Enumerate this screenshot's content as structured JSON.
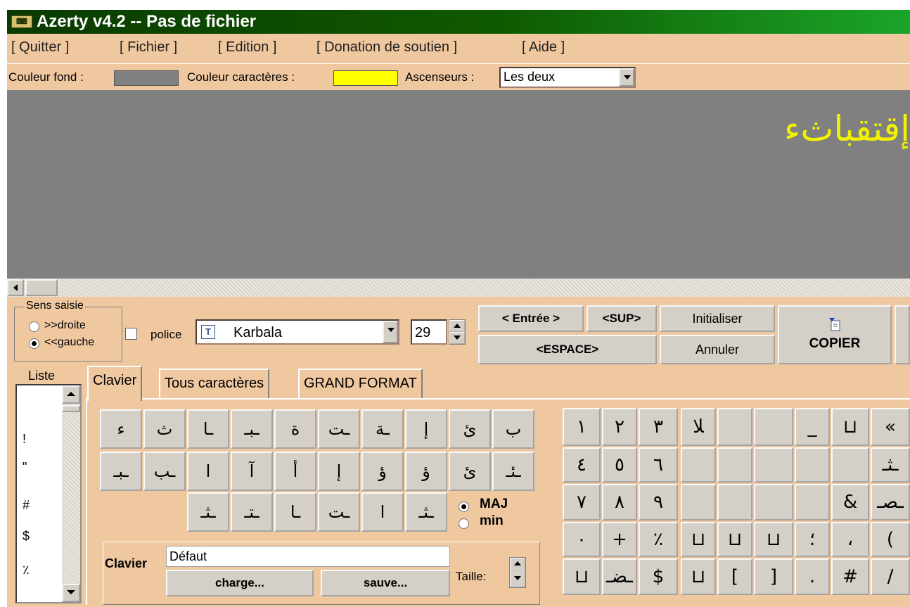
{
  "title": "Azerty v4.2 -- Pas de fichier",
  "app_icon": "keyboard-icon",
  "menu": [
    {
      "label": "[ Quitter ]"
    },
    {
      "label": "[ Fichier ]"
    },
    {
      "label": "[ Edition ]"
    },
    {
      "label": "[ Donation de soutien ]"
    },
    {
      "label": "[ Aide ]"
    }
  ],
  "toolbar": {
    "bg_label": "Couleur fond :",
    "bg_color": "#808080",
    "fg_label": "Couleur caractères :",
    "fg_color": "#ffff00",
    "scroll_label": "Ascenseurs :",
    "scroll_value": "Les deux"
  },
  "editor": {
    "text": "إقتقباثء",
    "bg_color": "#808080",
    "text_color": "#f2f200"
  },
  "direction": {
    "legend": "Sens saisie",
    "option_right": ">>droite",
    "option_left": "<<gauche",
    "selected": "<<gauche"
  },
  "font": {
    "checkbox_label": "police",
    "name": "Karbala",
    "size": "29"
  },
  "buttons": {
    "enter": "< Entrée >",
    "sup": "<SUP>",
    "space": "<ESPACE>",
    "init": "Initialiser",
    "cancel": "Annuler",
    "copy": "COPIER"
  },
  "list": {
    "label": "Liste",
    "items": [
      "!",
      "\"",
      "#",
      "$",
      "٪"
    ]
  },
  "tabs": [
    "Clavier",
    "Tous caractères",
    "GRAND FORMAT"
  ],
  "active_tab": "Clavier",
  "keyboard_rows": [
    [
      "ء",
      "ث",
      "ـا",
      "ـبـ",
      "ة",
      "ـت",
      "ـة",
      "إ",
      "ىٔ",
      "ب"
    ],
    [
      "ـبـ",
      "ـب",
      "ا",
      "آ",
      "أ",
      "إ",
      "ؤ",
      "ؤ",
      "ئ",
      "ـئـ"
    ],
    [
      "ـثـ",
      "ـتـ",
      "ـا",
      "ـت",
      "ا",
      "ـثـ"
    ]
  ],
  "case": {
    "maj": "MAJ",
    "min": "min",
    "selected": "MAJ"
  },
  "clavier": {
    "label": "Clavier",
    "value": "Défaut",
    "load": "charge...",
    "save": "sauve...",
    "size_label": "Taille:"
  },
  "right_grid": [
    [
      "١",
      "٢",
      "٣",
      "ﻼ",
      "",
      "",
      "_",
      "⊔",
      "«"
    ],
    [
      "٤",
      "٥",
      "٦",
      "",
      "",
      "",
      "",
      "",
      "ـثـ"
    ],
    [
      "٧",
      "٨",
      "٩",
      "",
      "",
      "",
      "",
      "&",
      "ـصـ"
    ],
    [
      "٠",
      "+",
      "٪",
      "⊔",
      "⊔",
      "⊔",
      "؛",
      "،",
      "("
    ],
    [
      "⊔",
      "ـضـ",
      "$",
      "⊔",
      "[",
      "]",
      ".",
      "#",
      "/"
    ]
  ]
}
